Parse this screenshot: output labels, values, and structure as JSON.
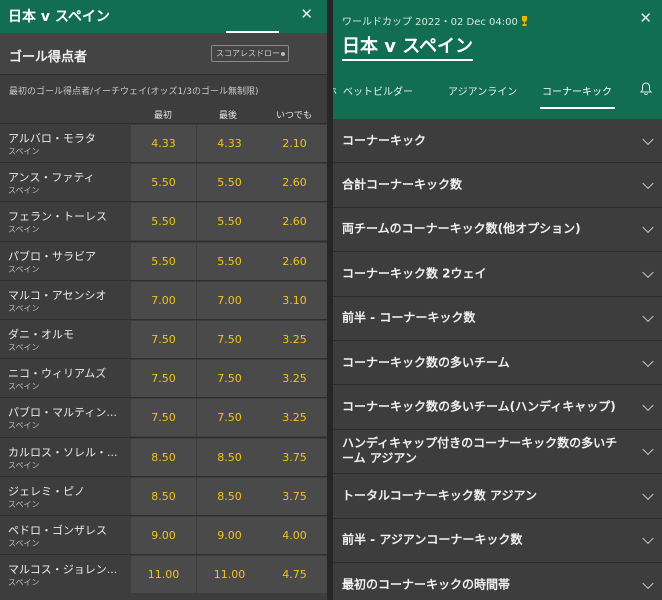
{
  "left": {
    "title": "日本 v スペイン",
    "section_title": "ゴール得点者",
    "scoreless_button": "スコアレスドロー",
    "description": "最初のゴール得点者/イーチウェイ(オッズ1/3のゴール無制限)",
    "columns": [
      "最初",
      "最後",
      "いつでも"
    ],
    "players": [
      {
        "name": "アルバロ・モラタ",
        "team": "スペイン",
        "first": "4.33",
        "last": "4.33",
        "anytime": "2.10"
      },
      {
        "name": "アンス・ファティ",
        "team": "スペイン",
        "first": "5.50",
        "last": "5.50",
        "anytime": "2.60"
      },
      {
        "name": "フェラン・トーレス",
        "team": "スペイン",
        "first": "5.50",
        "last": "5.50",
        "anytime": "2.60"
      },
      {
        "name": "パブロ・サラビア",
        "team": "スペイン",
        "first": "5.50",
        "last": "5.50",
        "anytime": "2.60"
      },
      {
        "name": "マルコ・アセンシオ",
        "team": "スペイン",
        "first": "7.00",
        "last": "7.00",
        "anytime": "3.10"
      },
      {
        "name": "ダニ・オルモ",
        "team": "スペイン",
        "first": "7.50",
        "last": "7.50",
        "anytime": "3.25"
      },
      {
        "name": "ニコ・ウィリアムズ",
        "team": "スペイン",
        "first": "7.50",
        "last": "7.50",
        "anytime": "3.25"
      },
      {
        "name": "パブロ・マルティン...",
        "team": "スペイン",
        "first": "7.50",
        "last": "7.50",
        "anytime": "3.25"
      },
      {
        "name": "カルロス・ソレル・...",
        "team": "スペイン",
        "first": "8.50",
        "last": "8.50",
        "anytime": "3.75"
      },
      {
        "name": "ジェレミ・ピノ",
        "team": "スペイン",
        "first": "8.50",
        "last": "8.50",
        "anytime": "3.75"
      },
      {
        "name": "ペドロ・ゴンザレス",
        "team": "スペイン",
        "first": "9.00",
        "last": "9.00",
        "anytime": "4.00"
      },
      {
        "name": "マルコス・ジョレン...",
        "team": "スペイン",
        "first": "11.00",
        "last": "11.00",
        "anytime": "4.75"
      }
    ]
  },
  "right": {
    "competition": "ワールドカップ 2022・02 Dec 04:00",
    "title": "日本 v スペイン",
    "tabs": [
      "ベットビルダー",
      "アジアンライン",
      "コーナーキック"
    ],
    "active_tab": "コーナーキック",
    "markets": [
      "コーナーキック",
      "合計コーナーキック数",
      "両チームのコーナーキック数(他オプション)",
      "コーナーキック数 2ウェイ",
      "前半 - コーナーキック数",
      "コーナーキック数の多いチーム",
      "コーナーキック数の多いチーム(ハンディキャップ)",
      "ハンディキャップ付きのコーナーキック数の多いチーム アジアン",
      "トータルコーナーキック数 アジアン",
      "前半 - アジアンコーナーキック数",
      "最初のコーナーキックの時間帯"
    ]
  },
  "colors": {
    "header_green": "#126e51",
    "odds_yellow": "#f2c417",
    "panel_bg": "#3d3d3d"
  },
  "icons": [
    "close-icon",
    "trophy-icon",
    "bell-icon",
    "chevron-down-icon"
  ]
}
